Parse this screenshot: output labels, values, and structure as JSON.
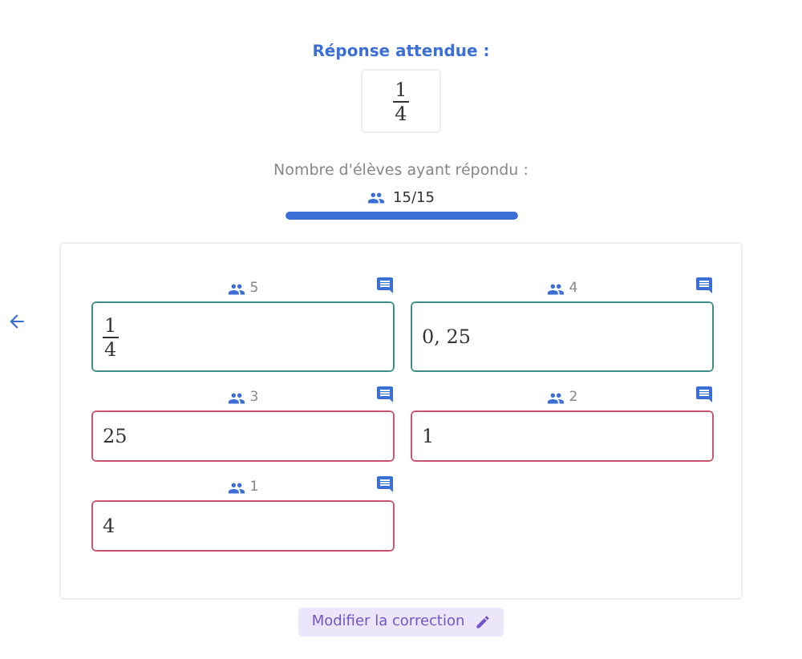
{
  "expected": {
    "title": "Réponse attendue :",
    "answer": {
      "kind": "fraction",
      "numerator": "1",
      "denominator": "4"
    }
  },
  "responses": {
    "label": "Nombre d'élèves ayant répondu :",
    "count": "15/15",
    "level": 1
  },
  "answers": [
    {
      "kind": "fraction",
      "numerator": "1",
      "denominator": "4",
      "students": "5",
      "correct": true
    },
    {
      "kind": "text",
      "value": "0, 25",
      "students": "4",
      "correct": true
    },
    {
      "kind": "text",
      "value": "25",
      "students": "3",
      "correct": false
    },
    {
      "kind": "text",
      "value": "1",
      "students": "2",
      "correct": false
    },
    {
      "kind": "text",
      "value": "4",
      "students": "1",
      "correct": false
    }
  ],
  "edit_button": "Modifier la correction"
}
